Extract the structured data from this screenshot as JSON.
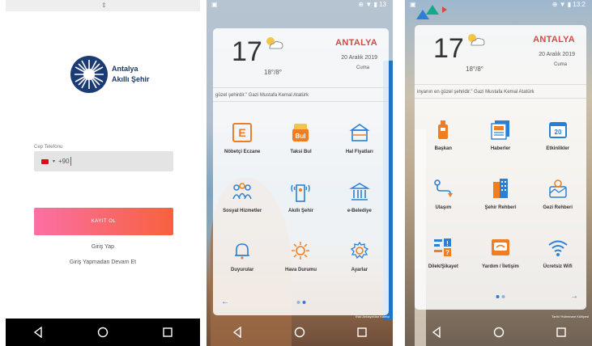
{
  "login": {
    "logo_line1": "Antalya",
    "logo_line2": "Akıllı Şehir",
    "phone_label": "Cep Telefonu",
    "country_code": "+90",
    "register_button": "KAYIT OL",
    "login_link": "Giriş Yap",
    "guest_link": "Giriş Yapmadan Devam Et"
  },
  "weather": {
    "temperature": "17",
    "range": "18°/8°",
    "city": "ANTALYA",
    "date": "20 Aralık 2019",
    "day": "Cuma",
    "icon": "partly-cloudy-icon"
  },
  "screen2": {
    "quote": "güzel şehirdir.\" Gazi Mustafa Kemal Atatürk",
    "tiles": [
      {
        "label": "Nöbetçi Eczane",
        "icon": "pharmacy-icon"
      },
      {
        "label": "Taksi Bul",
        "icon": "taxi-icon"
      },
      {
        "label": "Hal Fiyatları",
        "icon": "market-icon"
      },
      {
        "label": "Sosyal Hizmetler",
        "icon": "people-icon"
      },
      {
        "label": "Akıllı Şehir",
        "icon": "smart-city-icon"
      },
      {
        "label": "e-Belediye",
        "icon": "municipality-icon"
      },
      {
        "label": "Duyurular",
        "icon": "bell-icon"
      },
      {
        "label": "Hava Durumu",
        "icon": "sun-icon"
      },
      {
        "label": "Ayarlar",
        "icon": "gear-icon"
      }
    ],
    "credit": "Eski Antalya'dan Kaleiçi"
  },
  "screen3": {
    "quote": "inyanın en güzel şehridir.\" Gazi Mustafa Kemal Atatürk",
    "tiles": [
      {
        "label": "Başkan",
        "icon": "president-icon"
      },
      {
        "label": "Haberler",
        "icon": "news-icon"
      },
      {
        "label": "Etkinlikler",
        "icon": "calendar-icon"
      },
      {
        "label": "Ulaşım",
        "icon": "route-icon"
      },
      {
        "label": "Şehir Rehberi",
        "icon": "city-guide-icon"
      },
      {
        "label": "Gezi Rehberi",
        "icon": "travel-guide-icon"
      },
      {
        "label": "Dilek/Şikayet",
        "icon": "feedback-icon"
      },
      {
        "label": "Yardım / İletişim",
        "icon": "contact-icon"
      },
      {
        "label": "Ücretsiz Wifi",
        "icon": "wifi-icon"
      }
    ],
    "credit": "Tarihi Yivliminare Külliyesi"
  },
  "colors": {
    "accent_blue": "#2b7fd4",
    "city_red": "#d94646",
    "register_gradient_start": "#fb6fa4",
    "register_gradient_end": "#f8613e",
    "icon_orange": "#ef7d22"
  }
}
